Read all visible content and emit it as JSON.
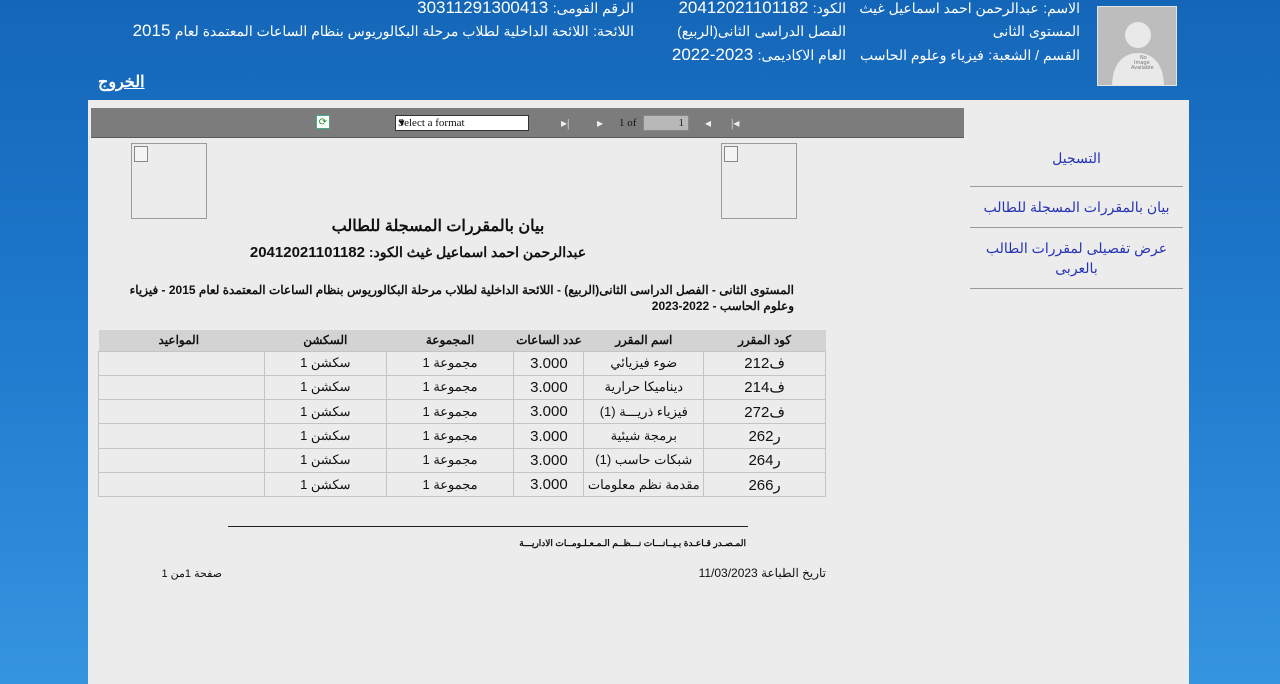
{
  "student": {
    "name_label": "الاسم:",
    "name": "عبدالرحمن احمد اسماعيل غيث",
    "code_label": "الكود:",
    "code": "20412021101182",
    "national_id_label": "الرقم القومى:",
    "national_id": "30311291300413",
    "level": "المستوى الثانى",
    "semester_label": "الفصل الدراسى",
    "semester": "الثانى(الربيع)",
    "regulation_label": "اللائحة:",
    "regulation": "اللائحة الداخلية لطلاب مرحلة البكالوريوس بنظام الساعات المعتمدة لعام",
    "regulation_year": "2015",
    "department_label": "القسم / الشعبة:",
    "department": "فيزياء وعلوم الحاسب",
    "academic_year_label": "العام الاكاديمى:",
    "academic_year": "2023-2022",
    "photo_text": "No Image Available"
  },
  "logout_label": "الخروج",
  "sidebar": {
    "items": [
      {
        "label": "التسجيل"
      },
      {
        "label": "بيان بالمقررات المسجلة للطالب"
      },
      {
        "label": "عرض تفصيلى لمقررات الطالب بالعربى"
      }
    ]
  },
  "toolbar": {
    "format_placeholder": "Select a format",
    "page_current": "1",
    "page_of": "1 of",
    "first_glyph": "|◂",
    "prev_glyph": "◂",
    "next_glyph": "▸",
    "last_glyph": "▸|"
  },
  "report": {
    "title": "بيان بالمقررات المسجلة للطالب",
    "name_line": "عبدالرحمن احمد اسماعيل غيث   الكود:",
    "code": "20412021101182",
    "info": "المستوى الثانى - الفصل الدراسى الثانى(الربيع) - اللائحة الداخلية لطلاب مرحلة البكالوريوس بنظام الساعات المعتمدة لعام 2015 - فيزياء وعلوم الحاسب - 2022-2023",
    "columns": [
      "كود المقرر",
      "اسم المقرر",
      "عدد الساعات",
      "المجموعة",
      "السكشن",
      "المواعيد"
    ],
    "rows": [
      {
        "code": "ف212",
        "name": "ضوء فيزيائي",
        "hours": "3.000",
        "group": "مجموعة 1",
        "section": "سكشن 1",
        "schedule": ""
      },
      {
        "code": "ف214",
        "name": "ديناميكا حرارية",
        "hours": "3.000",
        "group": "مجموعة 1",
        "section": "سكشن 1",
        "schedule": ""
      },
      {
        "code": "ف272",
        "name": "فيزياء ذريـــة (1)",
        "hours": "3.000",
        "group": "مجموعة 1",
        "section": "سكشن 1",
        "schedule": ""
      },
      {
        "code": "ر262",
        "name": "برمجة شيئية",
        "hours": "3.000",
        "group": "مجموعة 1",
        "section": "سكشن 1",
        "schedule": ""
      },
      {
        "code": "ر264",
        "name": "شبكات حاسب (1)",
        "hours": "3.000",
        "group": "مجموعة 1",
        "section": "سكشن 1",
        "schedule": ""
      },
      {
        "code": "ر266",
        "name": "مقدمة نظم معلومات",
        "hours": "3.000",
        "group": "مجموعة 1",
        "section": "سكشن 1",
        "schedule": ""
      }
    ],
    "source": "المـصـدر قـاعـدة بـيــانـــات نـــظــم الـمـعـلـومــات الاداريـــة",
    "print_date_label": "تاريخ الطباعة",
    "print_date": "11/03/2023",
    "page_label": "صفحة 1من 1"
  }
}
